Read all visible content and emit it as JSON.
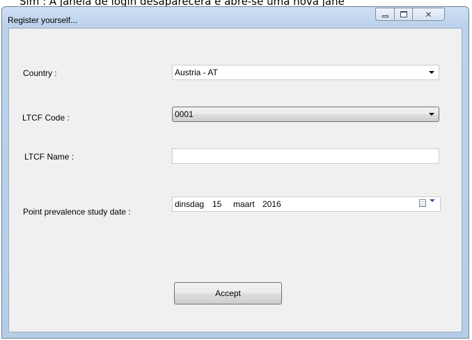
{
  "page_caption": "Sim : A janela de login desaparecerá e abre-se uma nova jane",
  "window": {
    "title": "Register yourself...",
    "controls": {
      "minimize": "minimize",
      "maximize": "maximize",
      "close": "close"
    }
  },
  "form": {
    "country": {
      "label": "Country :",
      "value": "Austria - AT"
    },
    "ltcf_code": {
      "label": "LTCF Code :",
      "value": "0001"
    },
    "ltcf_name": {
      "label": "LTCF Name :",
      "value": ""
    },
    "ppsd": {
      "label": "Point prevalence study date :",
      "weekday": "dinsdag",
      "day": "15",
      "month": "maart",
      "year": "2016"
    },
    "accept_label": "Accept"
  },
  "icons": {
    "dropdown": "chevron-down-icon",
    "calendar": "calendar-icon"
  },
  "colors": {
    "titlebar": "#bcd2ec",
    "client_bg": "#f0f0f0",
    "border": "#6e7f96"
  }
}
